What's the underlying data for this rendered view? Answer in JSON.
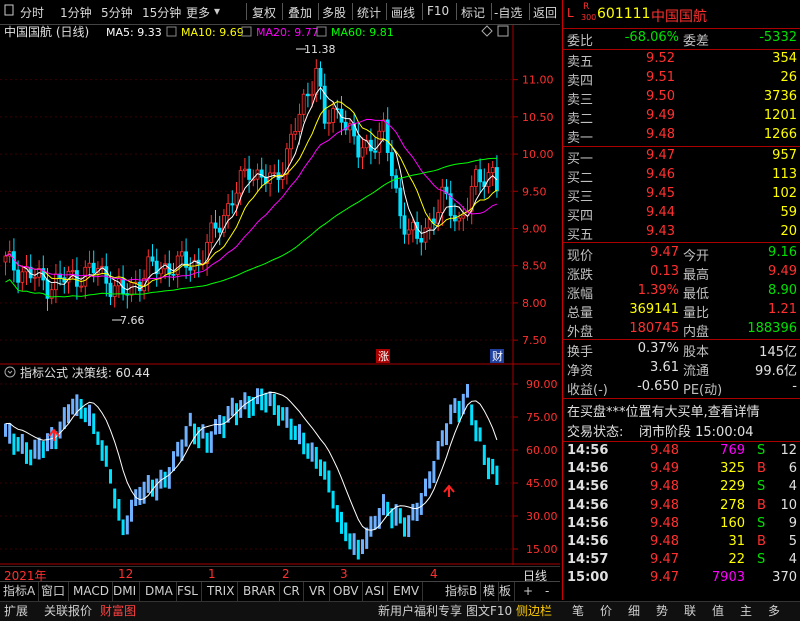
{
  "toolbar": {
    "periods": [
      "分时",
      "1分钟",
      "5分钟",
      "15分钟",
      "更多"
    ],
    "actions": [
      "复权",
      "叠加",
      "多股",
      "统计",
      "画线",
      "F10",
      "标记",
      "-自选",
      "返回"
    ]
  },
  "chart": {
    "title": "中国国航 (日线)",
    "ma_legend": [
      {
        "label": "MA5: 9.33",
        "color": "#ffffff"
      },
      {
        "label": "MA10: 9.69",
        "color": "#ffff00"
      },
      {
        "label": "MA20: 9.77",
        "color": "#ff00ff"
      },
      {
        "label": "MA60: 9.81",
        "color": "#00ff00"
      }
    ],
    "y_ticks": [
      "11.00",
      "10.50",
      "10.00",
      "9.50",
      "9.00",
      "8.50",
      "8.00",
      "7.50"
    ],
    "high_label": "11.38",
    "low_label": "7.66",
    "tag_zhang": "涨",
    "tag_cai": "财",
    "indicator_title": "指标公式 决策线: 60.44",
    "indicator_y_ticks": [
      "90.00",
      "75.00",
      "60.00",
      "45.00",
      "30.00",
      "15.00"
    ],
    "x_labels": [
      "2021年",
      "12",
      "1",
      "2",
      "3",
      "4"
    ],
    "period_label": "日线"
  },
  "chart_data": {
    "type": "candlestick",
    "ylim": [
      7.3,
      11.6
    ],
    "ma": {
      "MA5": 9.33,
      "MA10": 9.69,
      "MA20": 9.77,
      "MA60": 9.81
    },
    "high": 11.38,
    "low": 7.66,
    "indicator": {
      "name": "决策线",
      "value": 60.44,
      "ylim": [
        10,
        95
      ]
    }
  },
  "indicator_tabs": [
    "指标A",
    "窗口",
    "MACD",
    "DMI",
    "DMA",
    "FSL",
    "TRIX",
    "BRAR",
    "CR",
    "VR",
    "OBV",
    "ASI",
    "EMV",
    "指标B",
    "模",
    "板",
    "+",
    "-"
  ],
  "status_tabs": [
    "扩展",
    "关联报价",
    "财富图",
    "新用户福利专享",
    "图文F10",
    "侧边栏"
  ],
  "status_icons": [
    "笔",
    "价",
    "细",
    "势",
    "联",
    "值",
    "主",
    "多"
  ],
  "quote": {
    "code": "601111",
    "name": "中国国航",
    "badge_l": "L",
    "badge_r": "R",
    "badge_num": "300",
    "weibi_label": "委比",
    "weibi": "-68.06%",
    "weicha_label": "委差",
    "weicha": "-5332",
    "asks": [
      {
        "label": "卖五",
        "price": "9.52",
        "vol": "354"
      },
      {
        "label": "卖四",
        "price": "9.51",
        "vol": "26"
      },
      {
        "label": "卖三",
        "price": "9.50",
        "vol": "3736"
      },
      {
        "label": "卖二",
        "price": "9.49",
        "vol": "1201"
      },
      {
        "label": "卖一",
        "price": "9.48",
        "vol": "1266"
      }
    ],
    "bids": [
      {
        "label": "买一",
        "price": "9.47",
        "vol": "957"
      },
      {
        "label": "买二",
        "price": "9.46",
        "vol": "113"
      },
      {
        "label": "买三",
        "price": "9.45",
        "vol": "102"
      },
      {
        "label": "买四",
        "price": "9.44",
        "vol": "59"
      },
      {
        "label": "买五",
        "price": "9.43",
        "vol": "20"
      }
    ],
    "stats": [
      {
        "l1": "现价",
        "v1": "9.47",
        "c1": "red",
        "l2": "今开",
        "v2": "9.16",
        "c2": "green"
      },
      {
        "l1": "涨跌",
        "v1": "0.13",
        "c1": "red",
        "l2": "最高",
        "v2": "9.49",
        "c2": "red"
      },
      {
        "l1": "涨幅",
        "v1": "1.39%",
        "c1": "red",
        "l2": "最低",
        "v2": "8.90",
        "c2": "green"
      },
      {
        "l1": "总量",
        "v1": "369141",
        "c1": "yellow",
        "l2": "量比",
        "v2": "1.21",
        "c2": "red"
      },
      {
        "l1": "外盘",
        "v1": "180745",
        "c1": "red",
        "l2": "内盘",
        "v2": "188396",
        "c2": "green"
      }
    ],
    "stats2": [
      {
        "l1": "换手",
        "v1": "0.37%",
        "l2": "股本",
        "v2": "145亿"
      },
      {
        "l1": "净资",
        "v1": "3.61",
        "l2": "流通",
        "v2": "99.6亿"
      },
      {
        "l1": "收益(-)",
        "v1": "-0.650",
        "l2": "PE(动)",
        "v2": "-"
      }
    ],
    "notice": "在买盘***位置有大买单,查看详情",
    "trade_status_label": "交易状态:",
    "trade_status": "闭市阶段 15:00:04",
    "ticks": [
      {
        "time": "14:56",
        "price": "9.48",
        "vol": "769",
        "vc": "magenta",
        "side": "S",
        "n": "12"
      },
      {
        "time": "14:56",
        "price": "9.49",
        "vol": "325",
        "vc": "yellow",
        "side": "B",
        "n": "6"
      },
      {
        "time": "14:56",
        "price": "9.48",
        "vol": "229",
        "vc": "yellow",
        "side": "S",
        "n": "4"
      },
      {
        "time": "14:56",
        "price": "9.48",
        "vol": "278",
        "vc": "yellow",
        "side": "B",
        "n": "10"
      },
      {
        "time": "14:56",
        "price": "9.48",
        "vol": "160",
        "vc": "yellow",
        "side": "S",
        "n": "9"
      },
      {
        "time": "14:56",
        "price": "9.48",
        "vol": "31",
        "vc": "yellow",
        "side": "B",
        "n": "5"
      },
      {
        "time": "14:57",
        "price": "9.47",
        "vol": "22",
        "vc": "yellow",
        "side": "S",
        "n": "4"
      },
      {
        "time": "15:00",
        "price": "9.47",
        "vol": "7903",
        "vc": "magenta",
        "side": "",
        "n": "370"
      }
    ]
  }
}
